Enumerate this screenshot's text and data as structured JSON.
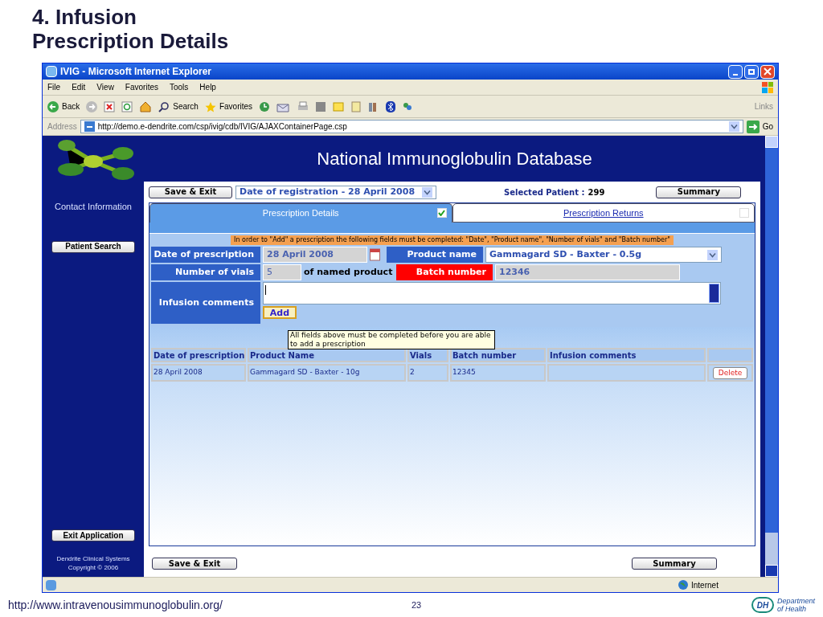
{
  "slide": {
    "title_lines": [
      "4. Infusion",
      "Prescription Details"
    ],
    "footer_url": "http://www.intravenousimmunoglobulin.org/",
    "page_number": "23",
    "logo": {
      "badge": "DH",
      "text_lines": [
        "Department",
        "of Health"
      ]
    }
  },
  "browser": {
    "title": "IVIG - Microsoft Internet Explorer",
    "menu": [
      "File",
      "Edit",
      "View",
      "Favorites",
      "Tools",
      "Help"
    ],
    "back": "Back",
    "search": "Search",
    "favorites": "Favorites",
    "links": "Links",
    "address_label": "Address",
    "url": "http://demo.e-dendrite.com/csp/ivig/cdb/IVIG/AJAXContainerPage.csp",
    "go": "Go",
    "status_zone": "Internet"
  },
  "app": {
    "title": "National Immunoglobulin Database",
    "sidebar": {
      "contact": "Contact Information",
      "patient_search": "Patient Search",
      "exit": "Exit Application",
      "footer_lines": [
        "Dendrite Clinical Systems",
        "Copyright © 2006"
      ]
    },
    "top": {
      "save_exit": "Save & Exit",
      "registration": "Date of registration - 28 April 2008",
      "patient_label": "Selected Patient :",
      "patient_value": "299",
      "summary": "Summary"
    },
    "tabs": [
      {
        "label": "Prescription Details",
        "selected": true,
        "checked": true
      },
      {
        "label": "Prescription Returns",
        "selected": false,
        "checked": false
      }
    ],
    "notice": "In order to \"Add\" a prescription the following fields must be completed: \"Date\", \"Product name\", \"Number of vials\" and \"Batch number\"",
    "fields": [
      {
        "label": "Date of prescription",
        "value": "28 April 2008",
        "invalid": false
      },
      {
        "label": "Product name",
        "value": "Gammagard SD - Baxter - 0.5g",
        "invalid": false
      },
      {
        "label": "Number of vials",
        "value": "5",
        "suffix": "of named product",
        "invalid": false
      },
      {
        "label": "Batch number",
        "value": "12346",
        "invalid": true
      },
      {
        "label": "Infusion comments",
        "invalid": false
      }
    ],
    "add": "Add",
    "tooltip": "All fields above must be completed before you are able to add a prescription",
    "table": {
      "columns": [
        "Date of prescription",
        "Product Name",
        "Vials",
        "Batch number",
        "Infusion comments"
      ],
      "rows": [
        {
          "cells": [
            "28 April 2008",
            "Gammagard SD - Baxter - 10g",
            "2",
            "12345",
            ""
          ],
          "action": "Delete"
        }
      ]
    },
    "bottom": {
      "save_exit": "Save & Exit",
      "summary": "Summary"
    }
  }
}
